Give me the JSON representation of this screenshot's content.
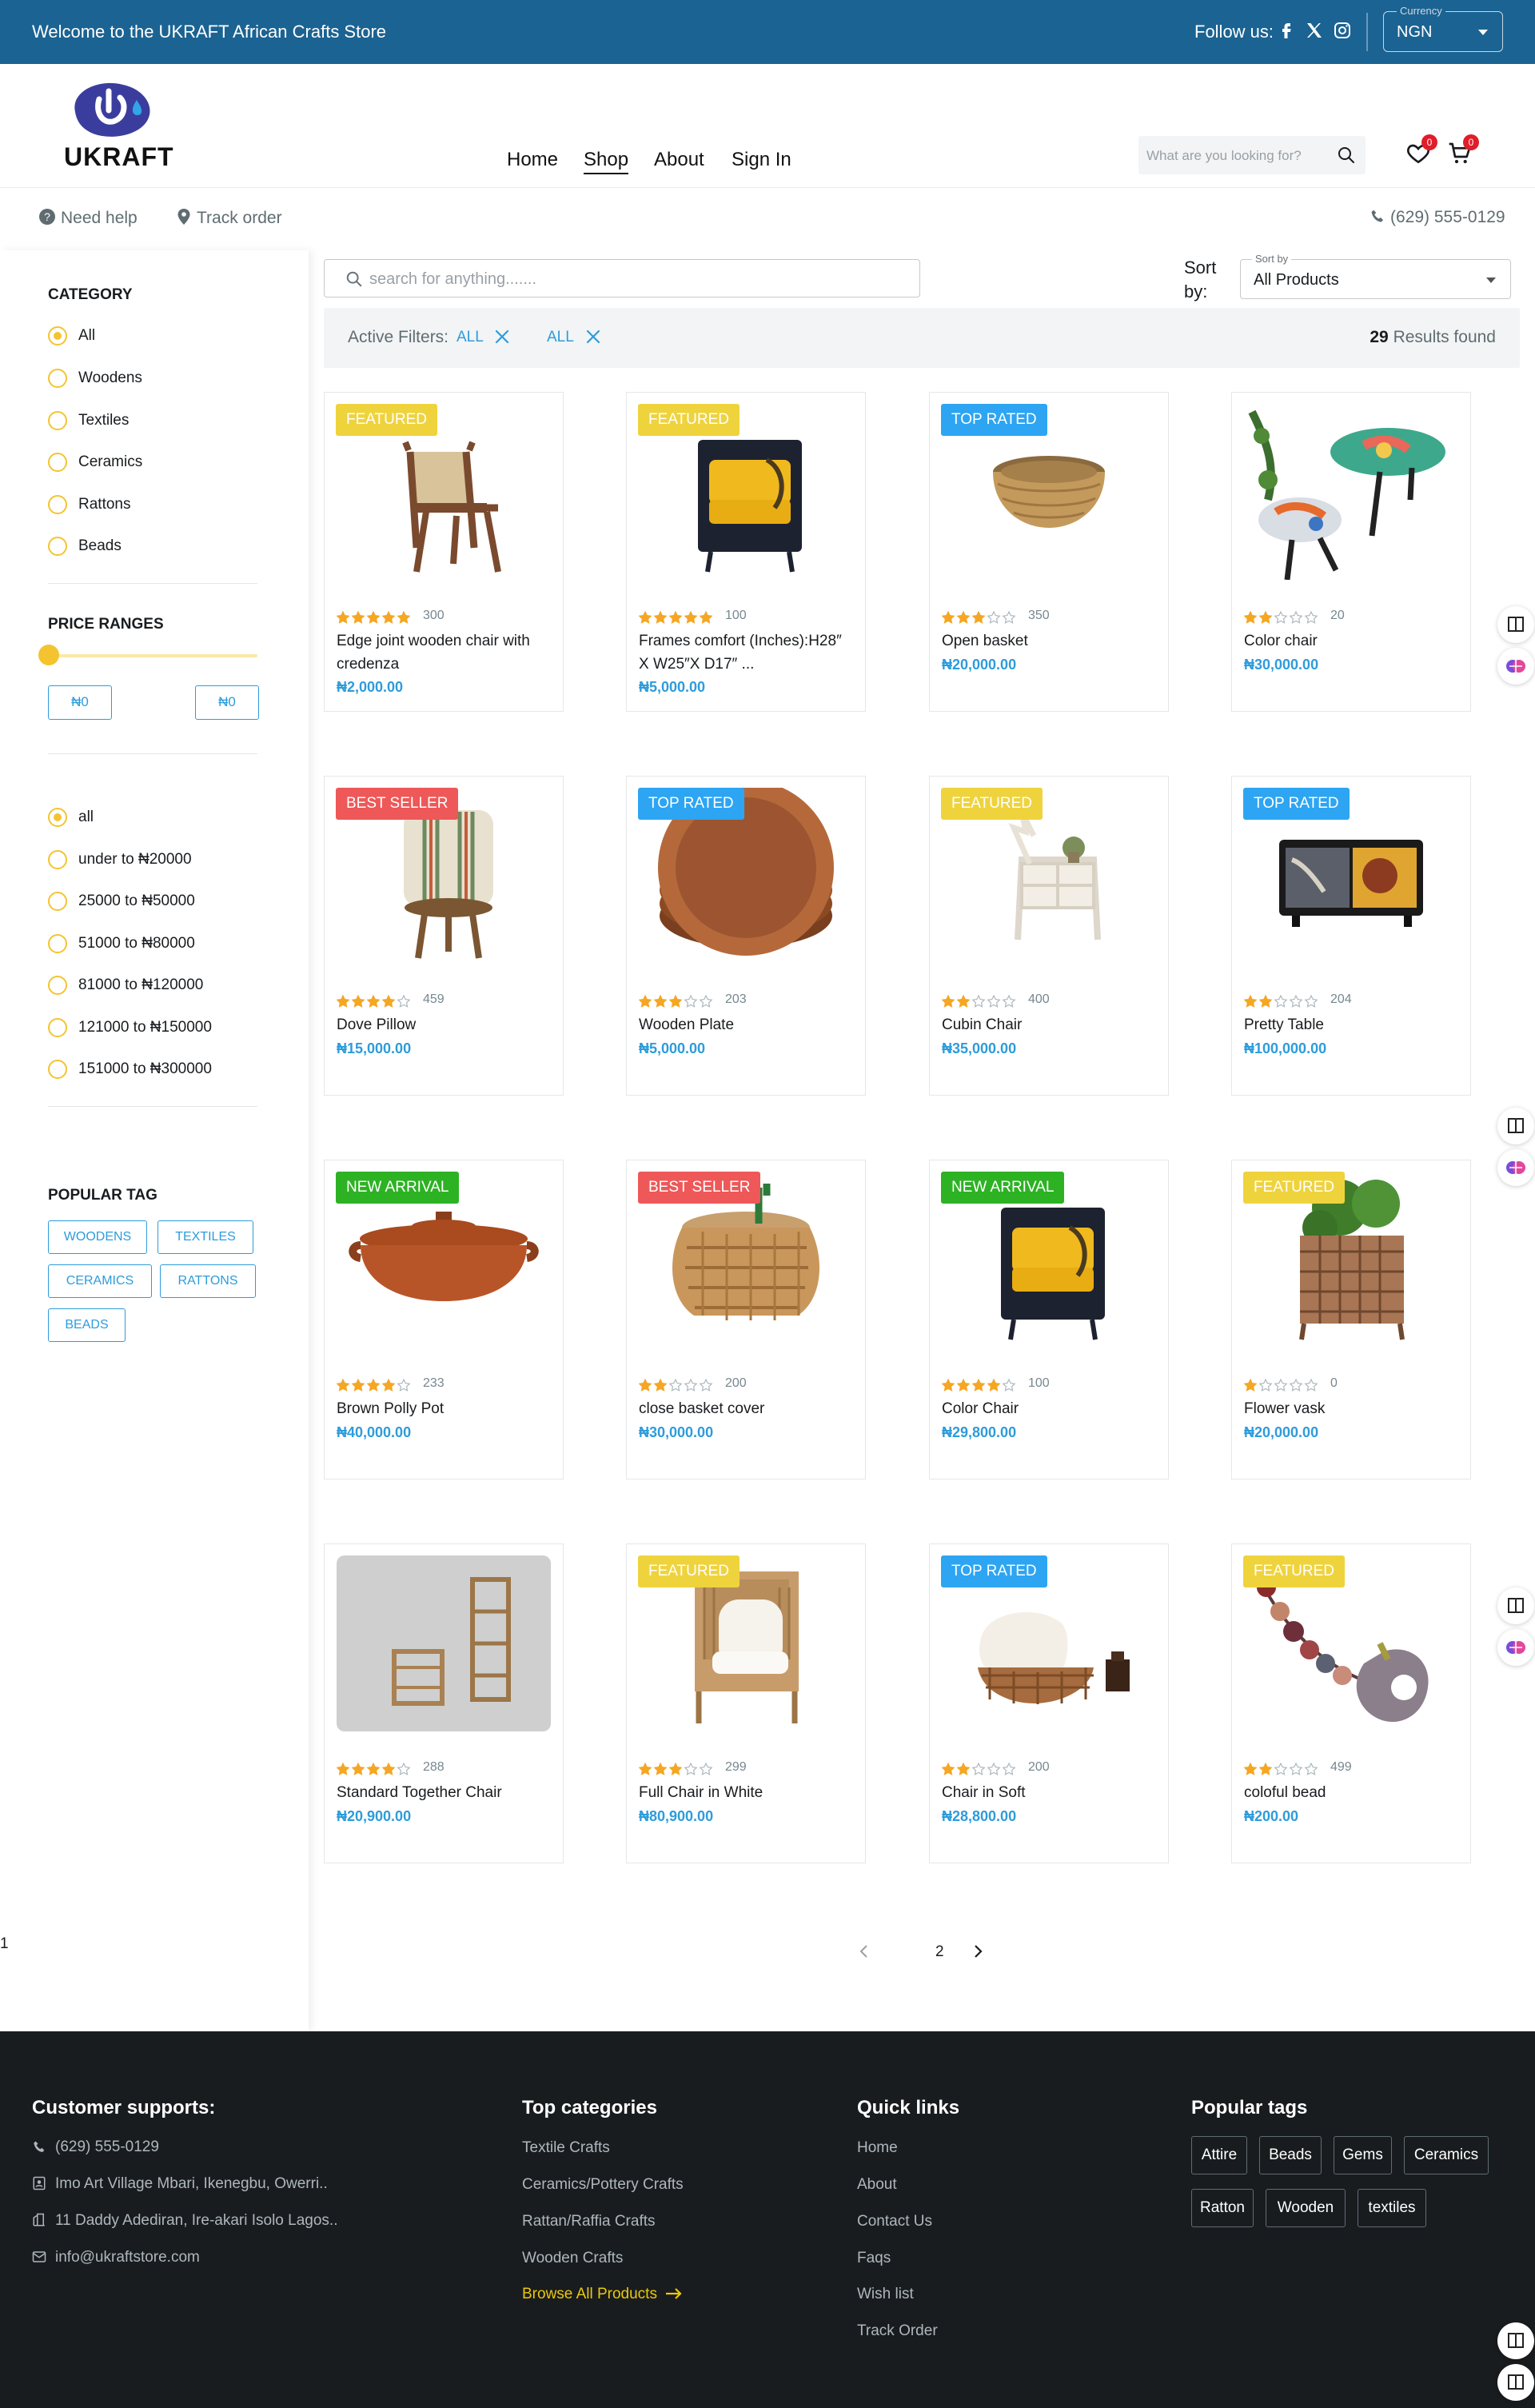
{
  "topbar": {
    "welcome": "Welcome to the UKRAFT African Crafts Store",
    "follow_label": "Follow us:",
    "currency_legend": "Currency",
    "currency_value": "NGN"
  },
  "brand": {
    "name": "UKRAFT"
  },
  "nav": {
    "home": "Home",
    "shop": "Shop",
    "about": "About",
    "sign_in": "Sign In"
  },
  "header_search": {
    "placeholder": "What are you looking for?"
  },
  "wishlist_count": "0",
  "cart_count": "0",
  "subbar": {
    "need_help": "Need help",
    "track_order": "Track order",
    "phone": "(629) 555-0129"
  },
  "sidebar": {
    "category_title": "CATEGORY",
    "categories": [
      "All",
      "Woodens",
      "Textiles",
      "Ceramics",
      "Rattons",
      "Beads"
    ],
    "price_title": "PRICE RANGES",
    "price_min": "₦0",
    "price_max": "₦0",
    "price_ranges": [
      "all",
      "under to ₦20000",
      "25000 to ₦50000",
      "51000 to ₦80000",
      "81000 to ₦120000",
      "121000 to ₦150000",
      "151000 to ₦300000"
    ],
    "tag_title": "POPULAR TAG",
    "tags": [
      "WOODENS",
      "TEXTILES",
      "CERAMICS",
      "RATTONS",
      "BEADS"
    ]
  },
  "main": {
    "search_placeholder": "search for anything.......",
    "sort_label": "Sort by:",
    "sort_legend": "Sort by",
    "sort_value": "All Products",
    "filters_label": "Active Filters:",
    "filters": [
      "ALL",
      "ALL"
    ],
    "results_count": "29",
    "results_text": "Results found"
  },
  "products": [
    {
      "badge": "FEATURED",
      "rating": 5,
      "count": "300",
      "name": "Edge joint wooden chair with credenza",
      "price": "₦2,000.00",
      "icon": "chair-icon"
    },
    {
      "badge": "FEATURED",
      "rating": 5,
      "count": "100",
      "name": "Frames comfort (Inches):H28″ X W25″X D17″ ...",
      "price": "₦5,000.00",
      "icon": "armchair-icon"
    },
    {
      "badge": "TOP RATED",
      "rating": 3,
      "count": "350",
      "name": "Open basket",
      "price": "₦20,000.00",
      "icon": "basket-icon"
    },
    {
      "badge": "",
      "rating": 2,
      "count": "20",
      "name": "Color chair",
      "price": "₦30,000.00",
      "icon": "stool-icon"
    },
    {
      "badge": "BEST SELLER",
      "rating": 4,
      "count": "459",
      "name": "Dove Pillow",
      "price": "₦15,000.00",
      "icon": "pillow-icon"
    },
    {
      "badge": "TOP RATED",
      "rating": 3,
      "count": "203",
      "name": "Wooden Plate",
      "price": "₦5,000.00",
      "icon": "plate-icon"
    },
    {
      "badge": "FEATURED",
      "rating": 2,
      "count": "400",
      "name": "Cubin Chair",
      "price": "₦35,000.00",
      "icon": "deer-shelf-icon"
    },
    {
      "badge": "TOP RATED",
      "rating": 2,
      "count": "204",
      "name": "Pretty Table",
      "price": "₦100,000.00",
      "icon": "cabinet-icon"
    },
    {
      "badge": "NEW ARRIVAL",
      "rating": 4,
      "count": "233",
      "name": "Brown Polly Pot",
      "price": "₦40,000.00",
      "icon": "pot-icon"
    },
    {
      "badge": "BEST SELLER",
      "rating": 2,
      "count": "200",
      "name": "close basket cover",
      "price": "₦30,000.00",
      "icon": "rattan-table-icon"
    },
    {
      "badge": "NEW ARRIVAL",
      "rating": 4,
      "count": "100",
      "name": "Color Chair",
      "price": "₦29,800.00",
      "icon": "armchair-icon"
    },
    {
      "badge": "FEATURED",
      "rating": 1,
      "count": "0",
      "name": "Flower vask",
      "price": "₦20,000.00",
      "icon": "planter-icon"
    },
    {
      "badge": "",
      "rating": 4,
      "count": "288",
      "name": "Standard Together Chair",
      "price": "₦20,900.00",
      "icon": "plant-stand-icon"
    },
    {
      "badge": "FEATURED",
      "rating": 3,
      "count": "299",
      "name": "Full Chair in White",
      "price": "₦80,900.00",
      "icon": "white-chair-icon"
    },
    {
      "badge": "TOP RATED",
      "rating": 2,
      "count": "200",
      "name": "Chair in Soft",
      "price": "₦28,800.00",
      "icon": "lounge-chair-icon"
    },
    {
      "badge": "FEATURED",
      "rating": 2,
      "count": "499",
      "name": "coloful bead",
      "price": "₦200.00",
      "icon": "bead-necklace-icon"
    }
  ],
  "badge_colors": {
    "FEATURED": "#EFD33D",
    "TOP RATED": "#2DA5F3",
    "BEST SELLER": "#EE5858",
    "NEW ARRIVAL": "#2DB224"
  },
  "pagination": {
    "current": "1",
    "next": "2"
  },
  "footer": {
    "support_title": "Customer supports:",
    "support_items": [
      "(629) 555-0129",
      "Imo Art Village Mbari, Ikenegbu, Owerri..",
      "11 Daddy Adediran, Ire-akari Isolo Lagos..",
      "info@ukraftstore.com"
    ],
    "categories_title": "Top categories",
    "categories": [
      "Textile Crafts",
      "Ceramics/Pottery Crafts",
      "Rattan/Raffia Crafts",
      "Wooden Crafts"
    ],
    "browse_all": "Browse All Products",
    "quick_title": "Quick links",
    "quick_links": [
      "Home",
      "About",
      "Contact Us",
      "Faqs",
      "Wish list",
      "Track Order"
    ],
    "tags_title": "Popular tags",
    "tags": [
      "Attire",
      "Beads",
      "Gems",
      "Ceramics",
      "Ratton",
      "Wooden",
      "textiles"
    ]
  },
  "colors": {
    "topbar": "#1B6392",
    "accent_blue": "#2D9CDB",
    "accent_yellow": "#F4C430",
    "footer": "#191C1F",
    "pager_active": "#9B27B0"
  }
}
